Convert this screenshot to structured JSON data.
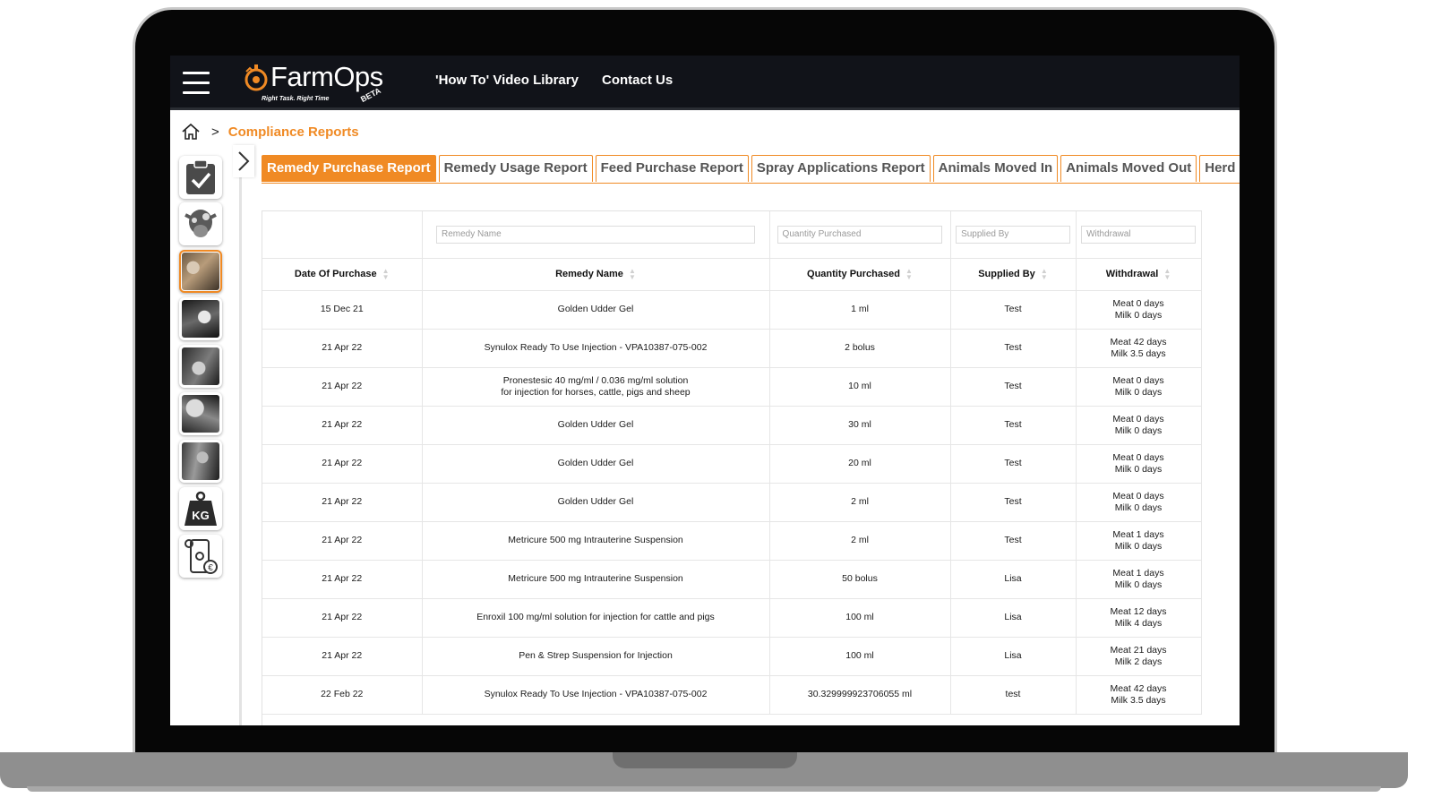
{
  "header": {
    "logo_word": "FarmOps",
    "logo_tagline": "Right Task. Right Time",
    "logo_badge": "BETA",
    "nav": [
      "'How To' Video Library",
      "Contact Us"
    ]
  },
  "breadcrumb": {
    "current": "Compliance Reports",
    "separator": ">"
  },
  "tabs": [
    "Remedy Purchase Report",
    "Remedy Usage Report",
    "Feed Purchase Report",
    "Spray Applications Report",
    "Animals Moved In",
    "Animals Moved Out",
    "Herd M"
  ],
  "rail_items": [
    "clipboard-check",
    "cow",
    "cattle-photo",
    "herd-photo",
    "calf-photo",
    "dairy-photo",
    "yard-photo",
    "weight-kg",
    "phone-euro"
  ],
  "rail_labels": {
    "weight": "KG"
  },
  "filters": {
    "remedy_name": "Remedy Name",
    "quantity_purchased": "Quantity Purchased",
    "supplied_by": "Supplied By",
    "withdrawal": "Withdrawal"
  },
  "columns": [
    "Date Of Purchase",
    "Remedy Name",
    "Quantity Purchased",
    "Supplied By",
    "Withdrawal"
  ],
  "rows": [
    [
      "15 Dec 21",
      "Golden Udder Gel",
      "1 ml",
      "Test",
      "Meat 0 days\nMilk 0 days"
    ],
    [
      "21 Apr 22",
      "Synulox Ready To Use Injection - VPA10387-075-002",
      "2 bolus",
      "Test",
      "Meat 42 days\nMilk 3.5 days"
    ],
    [
      "21 Apr 22",
      "Pronestesic 40 mg/ml / 0.036 mg/ml solution\nfor injection for horses, cattle, pigs and sheep",
      "10 ml",
      "Test",
      "Meat 0 days\nMilk 0 days"
    ],
    [
      "21 Apr 22",
      "Golden Udder Gel",
      "30 ml",
      "Test",
      "Meat 0 days\nMilk 0 days"
    ],
    [
      "21 Apr 22",
      "Golden Udder Gel",
      "20 ml",
      "Test",
      "Meat 0 days\nMilk 0 days"
    ],
    [
      "21 Apr 22",
      "Golden Udder Gel",
      "2 ml",
      "Test",
      "Meat 0 days\nMilk 0 days"
    ],
    [
      "21 Apr 22",
      "Metricure 500 mg Intrauterine Suspension",
      "2 ml",
      "Test",
      "Meat 1 days\nMilk 0 days"
    ],
    [
      "21 Apr 22",
      "Metricure 500 mg Intrauterine Suspension",
      "50 bolus",
      "Lisa",
      "Meat 1 days\nMilk 0 days"
    ],
    [
      "21 Apr 22",
      "Enroxil 100 mg/ml solution for injection for cattle and pigs",
      "100 ml",
      "Lisa",
      "Meat 12 days\nMilk 4 days"
    ],
    [
      "21 Apr 22",
      "Pen & Strep Suspension for Injection",
      "100 ml",
      "Lisa",
      "Meat 21 days\nMilk 2 days"
    ],
    [
      "22 Feb 22",
      "Synulox Ready To Use Injection - VPA10387-075-002",
      "30.329999923706055 ml",
      "test",
      "Meat 42 days\nMilk 3.5 days"
    ]
  ],
  "colors": {
    "accent": "#f08a24",
    "topbar": "#111319",
    "frame": "#060606"
  }
}
